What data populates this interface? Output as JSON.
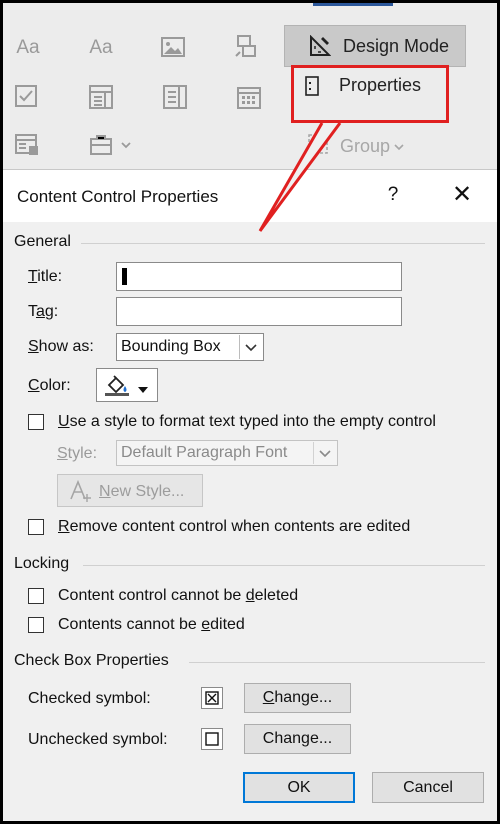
{
  "ribbon": {
    "style_sample_1": "Aa",
    "style_sample_2": "Aa",
    "design_mode_label": "Design Mode",
    "properties_label": "Properties",
    "group_label": "Group",
    "accent_color": "#2b579a"
  },
  "callout": {
    "color": "#e02020"
  },
  "dialog": {
    "title": "Content Control Properties",
    "help_label": "?",
    "close_label": "✕",
    "general": {
      "heading": "General",
      "title_label": {
        "u": "T",
        "rest": "itle:"
      },
      "title_value": "",
      "tag_label": {
        "pre": "T",
        "u": "a",
        "rest": "g:"
      },
      "tag_value": "",
      "show_as_label": {
        "u": "S",
        "rest": "how as:"
      },
      "show_as_value": "Bounding Box",
      "color_label": {
        "u": "C",
        "rest": "olor:"
      },
      "use_style_label": {
        "u": "U",
        "rest": "se a style to format text typed into the empty control"
      },
      "use_style_checked": false,
      "style_label": {
        "u": "S",
        "rest": "tyle:"
      },
      "style_value": "Default Paragraph Font",
      "new_style_label": {
        "u": "N",
        "rest": "ew Style..."
      },
      "remove_label": {
        "u": "R",
        "rest": "emove content control when contents are edited"
      },
      "remove_checked": false
    },
    "locking": {
      "heading": "Locking",
      "cannot_delete_label": {
        "pre": "Content control cannot be ",
        "u": "d",
        "rest": "eleted"
      },
      "cannot_delete_checked": false,
      "cannot_edit_label": {
        "pre": "Contents cannot be ",
        "u": "e",
        "rest": "dited"
      },
      "cannot_edit_checked": false
    },
    "checkbox_props": {
      "heading": "Check Box Properties",
      "checked_symbol_label": "Checked symbol:",
      "checked_symbol": "☒",
      "unchecked_symbol_label": "Unchecked symbol:",
      "unchecked_symbol": "☐",
      "change_checked_label": {
        "u": "C",
        "rest": "hange..."
      },
      "change_unchecked_label": {
        "pre": "Chan",
        "u": "g",
        "rest": "e..."
      }
    },
    "ok_label": "OK",
    "cancel_label": "Cancel"
  }
}
